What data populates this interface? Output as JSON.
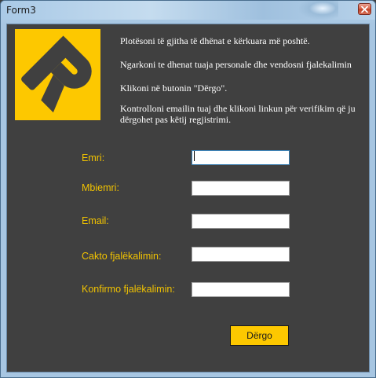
{
  "window": {
    "title": "Form3"
  },
  "instructions": {
    "line1": "Plotësoni të gjitha të dhënat e kërkuara më poshtë.",
    "line2": "Ngarkoni te dhenat tuaja personale dhe vendosni fjalekalimin",
    "line3": "Klikoni në butonin \"Dërgo\".",
    "line4": "Kontrolloni emailin tuaj dhe klikoni linkun për verifikim që ju dërgohet pas këtij regjistrimi."
  },
  "form": {
    "first_name_label": "Emri:",
    "first_name_value": "",
    "last_name_label": "Mbiemri:",
    "last_name_value": "",
    "email_label": "Email:",
    "email_value": "",
    "password_label": "Cakto fjalëkalimin:",
    "password_value": "",
    "confirm_password_label": "Konfirmo fjalëkalimin:",
    "confirm_password_value": "",
    "submit_label": "Dërgo"
  },
  "colors": {
    "background": "#404040",
    "accent_yellow": "#fdc800",
    "label_yellow": "#f2c300",
    "logo_dark": "#404040"
  },
  "icons": {
    "logo": "r-logo-icon",
    "close": "close-icon"
  }
}
